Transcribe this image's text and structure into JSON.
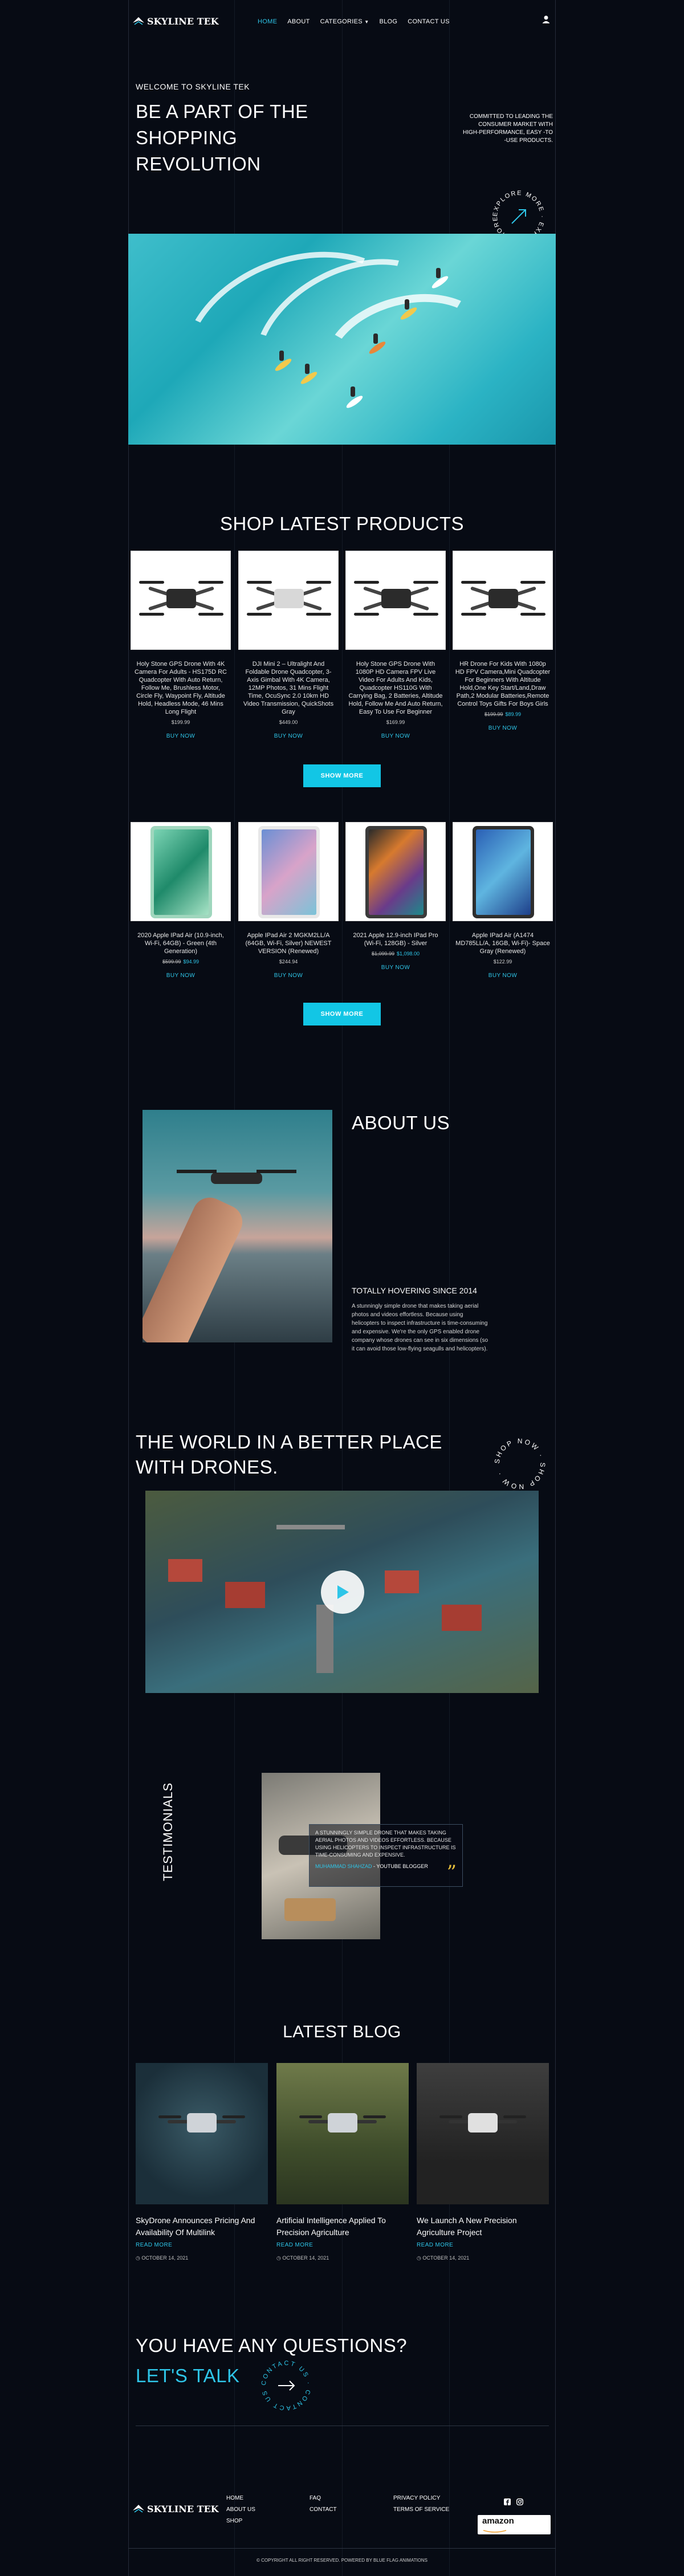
{
  "header": {
    "logo_text": "SKYLINE TEK",
    "nav": [
      "HOME",
      "ABOUT",
      "CATEGORIES",
      "BLOG",
      "CONTACT US"
    ],
    "active_nav": "HOME",
    "user_icon": "user-icon"
  },
  "hero": {
    "eyebrow": "WELCOME TO SKYLINE TEK",
    "headline_1": "BE A PART OF THE",
    "headline_2": "SHOPPING",
    "headline_3": "REVOLUTION",
    "tagline": "COMMITTED TO LEADING THE CONSUMER MARKET WITH HIGH-PERFORMANCE, EASY -TO -USE PRODUCTS.",
    "badge_text": "EXPLORE MORE · EXPLORE MORE ·"
  },
  "shop": {
    "title": "SHOP LATEST PRODUCTS",
    "buy_label": "BUY NOW",
    "show_more_label": "SHOW MORE",
    "row1": [
      {
        "name": "Holy Stone GPS Drone With 4K Camera For Adults - HS175D RC Quadcopter With Auto Return, Follow Me, Brushless Motor, Circle Fly, Waypoint Fly, Altitude Hold, Headless Mode, 46 Mins Long Flight",
        "old": "",
        "price": "$199.99"
      },
      {
        "name": "DJI Mini 2 – Ultralight And Foldable Drone Quadcopter, 3-Axis Gimbal With 4K Camera, 12MP Photos, 31 Mins Flight Time, OcuSync 2.0 10km HD Video Transmission, QuickShots Gray",
        "old": "",
        "price": "$449.00"
      },
      {
        "name": "Holy Stone GPS Drone With 1080P HD Camera FPV Live Video For Adults And Kids, Quadcopter HS110G With Carrying Bag, 2 Batteries, Altitude Hold, Follow Me And Auto Return, Easy To Use For Beginner",
        "old": "",
        "price": "$169.99"
      },
      {
        "name": "HR Drone For Kids With 1080p HD FPV Camera,Mini Quadcopter For Beginners With Altitude Hold,One Key Start/Land,Draw Path,2 Modular Batteries,Remote Control Toys Gifts For Boys Girls",
        "old": "$199.99",
        "price": "$89.99"
      }
    ],
    "row2": [
      {
        "name": "2020 Apple IPad Air (10.9-inch, Wi-Fi, 64GB) - Green (4th Generation)",
        "old": "$599.99",
        "price": "$94.99"
      },
      {
        "name": "Apple IPad Air 2 MGKM2LL/A (64GB, Wi-Fi, Silver) NEWEST VERSION (Renewed)",
        "old": "",
        "price": "$244.94"
      },
      {
        "name": "2021 Apple 12.9-inch IPad Pro (Wi-Fi, 128GB) - Silver",
        "old": "$1,099.99",
        "price": "$1,098.00"
      },
      {
        "name": "Apple IPad Air (A1474 MD785LL/A, 16GB, Wi-Fi)- Space Gray (Renewed)",
        "old": "",
        "price": "$122.99"
      }
    ]
  },
  "about": {
    "title": "ABOUT US",
    "subtitle": "TOTALLY HOVERING SINCE 2014",
    "body": "A stunningly simple drone that makes taking aerial photos and videos effortless. Because using helicopters to inspect infrastructure is time-consuming and expensive. We're the only GPS enabled drone company whose drones can see in six dimensions (so it can avoid those low-flying seagulls and helicopters)."
  },
  "world": {
    "title_1": "THE WORLD IN A BETTER PLACE",
    "title_2": "WITH DRONES.",
    "badge_text": "SHOP NOW · SHOP NOW ·",
    "play_icon": "play-icon"
  },
  "testimonials": {
    "label": "TESTIMONIALS",
    "quote": "A STUNNINGLY SIMPLE DRONE THAT MAKES TAKING AERIAL PHOTOS AND VIDEOS EFFORTLESS. BECAUSE USING HELICOPTERS TO INSPECT INFRASTRUCTURE IS TIME-CONSUMING AND EXPENSIVE.",
    "author": "MUHAMMAD SHAHZAD",
    "role": "- YOUTUBE BLOGGER",
    "quote_icon": "quote-icon"
  },
  "blog": {
    "title": "LATEST BLOG",
    "read_more": "READ MORE",
    "posts": [
      {
        "title": "SkyDrone Announces Pricing And Availability Of Multilink",
        "date": "OCTOBER 14, 2021"
      },
      {
        "title": "Artificial Intelligence Applied To Precision Agriculture",
        "date": "OCTOBER 14, 2021"
      },
      {
        "title": "We Launch A New Precision Agriculture Project",
        "date": "OCTOBER 14, 2021"
      }
    ]
  },
  "cta": {
    "question": "YOU HAVE ANY QUESTIONS?",
    "talk": "LET'S TALK",
    "badge_text": "CONTACT US · CONTACT US ·"
  },
  "footer": {
    "logo_text": "SKYLINE TEK",
    "col1": [
      "HOME",
      "ABOUT US",
      "SHOP"
    ],
    "col2": [
      "FAQ",
      "CONTACT"
    ],
    "col3": [
      "PRIVACY POLICY",
      "TERMS OF SERVICE"
    ],
    "social": [
      "facebook-icon",
      "instagram-icon"
    ],
    "amazon_text": "amazon",
    "amazon_sub": "",
    "copyright": "© COPYRIGHT ALL RIGHT RESERVED. POWERED BY BLUE FLAG ANIMATIONS"
  },
  "colors": {
    "accent": "#2ec5e8",
    "background": "#070b14",
    "button": "#12c6e5"
  }
}
